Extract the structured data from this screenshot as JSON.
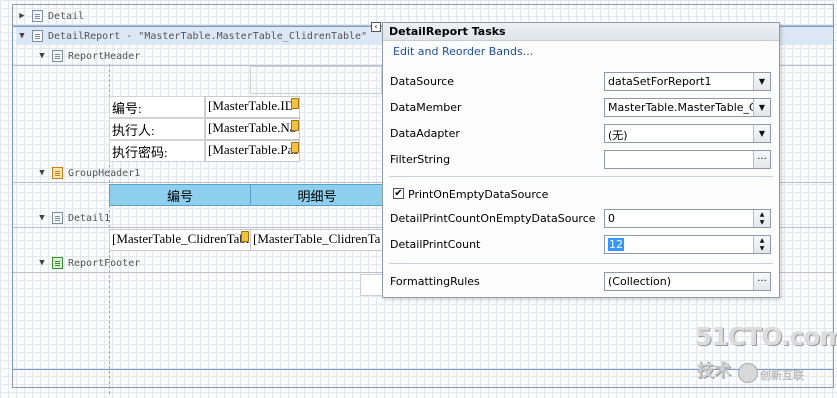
{
  "bands": {
    "detail": "Detail",
    "detail_report": "DetailReport - \"MasterTable.MasterTable_ClidrenTable\"",
    "report_header": "ReportHeader",
    "group_header": "GroupHeader1",
    "detail1": "Detail1",
    "report_footer": "ReportFooter"
  },
  "report_header": {
    "rows": [
      {
        "label": "编号:",
        "field": "[MasterTable.ID"
      },
      {
        "label": "执行人:",
        "field": "[MasterTable.Na"
      },
      {
        "label": "执行密码:",
        "field": "[MasterTable.Pas"
      }
    ]
  },
  "group_header": {
    "columns": [
      "编号",
      "明细号"
    ]
  },
  "detail1": {
    "cells": [
      "[MasterTable_ClidrenTabl",
      "[MasterTable_ClidrenTa"
    ]
  },
  "tasks": {
    "title": "DetailReport Tasks",
    "link": "Edit and Reorder Bands...",
    "datasource_label": "DataSource",
    "datasource_value": "dataSetForReport1",
    "datamember_label": "DataMember",
    "datamember_value": "MasterTable.MasterTable_C",
    "dataadapter_label": "DataAdapter",
    "dataadapter_value": "(无)",
    "filterstring_label": "FilterString",
    "filterstring_value": "",
    "print_on_empty_label": "PrintOnEmptyDataSource",
    "print_on_empty_checked": "✔",
    "count_on_empty_label": "DetailPrintCountOnEmptyDataSource",
    "count_on_empty_value": "0",
    "print_count_label": "DetailPrintCount",
    "print_count_value": "12",
    "formatting_label": "FormattingRules",
    "formatting_value": "(Collection)"
  },
  "watermark": {
    "site": "51CTO.com",
    "tech": "技术",
    "brand": "创新互联"
  },
  "colors": {
    "header_cell": "#8ecfee",
    "link": "#1f4f9c",
    "selection": "#3399ff"
  }
}
